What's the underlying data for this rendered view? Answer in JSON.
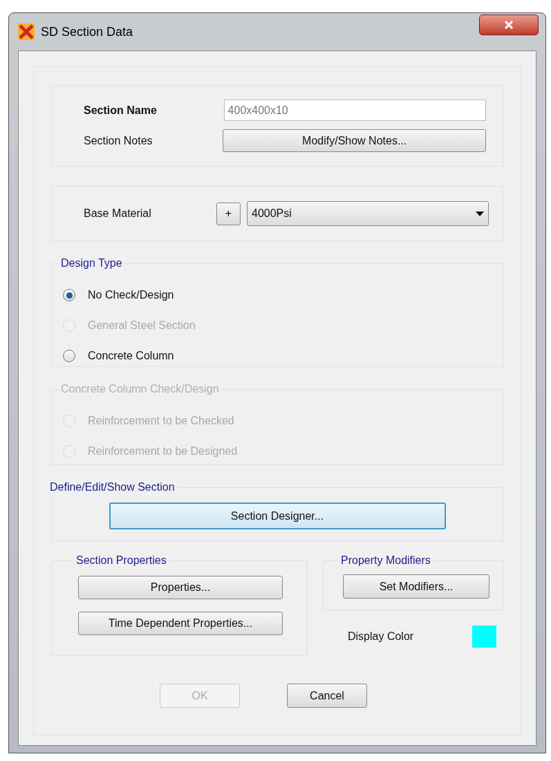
{
  "window": {
    "title": "SD Section Data"
  },
  "section_name": {
    "label": "Section Name",
    "value": "400x400x10"
  },
  "section_notes": {
    "label": "Section Notes",
    "button": "Modify/Show Notes..."
  },
  "base_material": {
    "label": "Base Material",
    "add_button": "+",
    "value": "4000Psi"
  },
  "design_type": {
    "legend": "Design Type",
    "options": [
      {
        "label": "No Check/Design",
        "selected": true,
        "disabled": false
      },
      {
        "label": "General Steel Section",
        "selected": false,
        "disabled": true
      },
      {
        "label": "Concrete Column",
        "selected": false,
        "disabled": false
      }
    ]
  },
  "concrete_column_design": {
    "legend": "Concrete Column Check/Design",
    "disabled": true,
    "options": [
      {
        "label": "Reinforcement to be Checked",
        "selected": false,
        "disabled": true
      },
      {
        "label": "Reinforcement to be Designed",
        "selected": false,
        "disabled": true
      }
    ]
  },
  "define_section": {
    "legend": "Define/Edit/Show Section",
    "button": "Section Designer..."
  },
  "section_properties": {
    "legend": "Section Properties",
    "buttons": [
      "Properties...",
      "Time Dependent Properties..."
    ]
  },
  "property_modifiers": {
    "legend": "Property Modifiers",
    "button": "Set Modifiers..."
  },
  "display_color": {
    "label": "Display Color",
    "color": "#00ffff"
  },
  "buttons": [
    {
      "label": "OK",
      "disabled": true
    },
    {
      "label": "Cancel",
      "disabled": false
    }
  ]
}
